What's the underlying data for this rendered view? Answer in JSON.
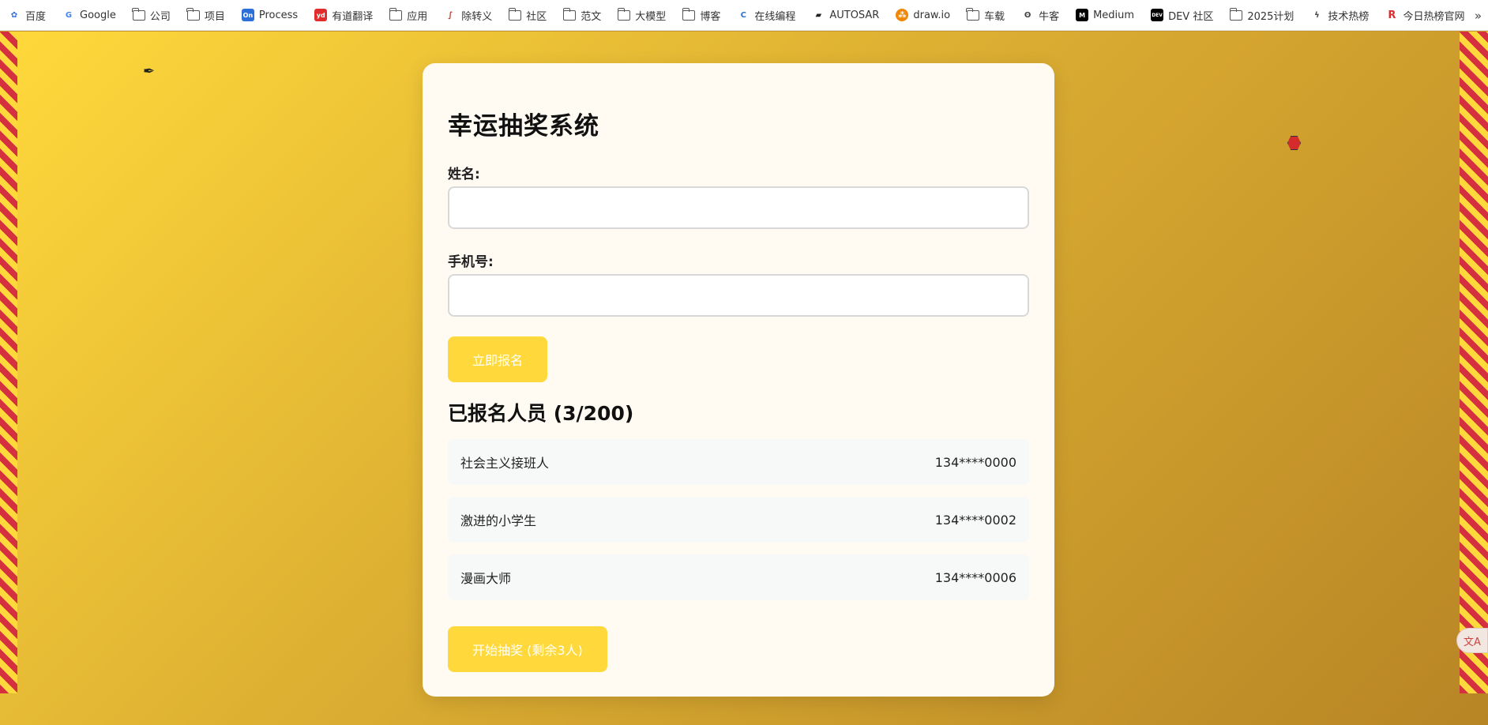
{
  "bookmarks": [
    {
      "label": "百度",
      "icon": "baidu-icon"
    },
    {
      "label": "Google",
      "icon": "google-icon"
    },
    {
      "label": "公司",
      "icon": "folder-icon"
    },
    {
      "label": "项目",
      "icon": "folder-icon"
    },
    {
      "label": "Process",
      "icon": "processon-icon"
    },
    {
      "label": "有道翻译",
      "icon": "youdao-icon"
    },
    {
      "label": "应用",
      "icon": "folder-icon"
    },
    {
      "label": "除转义",
      "icon": "unescape-icon"
    },
    {
      "label": "社区",
      "icon": "folder-icon"
    },
    {
      "label": "范文",
      "icon": "folder-icon"
    },
    {
      "label": "大模型",
      "icon": "folder-icon"
    },
    {
      "label": "博客",
      "icon": "folder-icon"
    },
    {
      "label": "在线编程",
      "icon": "online-coding-icon"
    },
    {
      "label": "AUTOSAR",
      "icon": "autosar-icon"
    },
    {
      "label": "draw.io",
      "icon": "drawio-icon"
    },
    {
      "label": "车载",
      "icon": "folder-icon"
    },
    {
      "label": "牛客",
      "icon": "nowcoder-icon"
    },
    {
      "label": "Medium",
      "icon": "medium-icon"
    },
    {
      "label": "DEV 社区",
      "icon": "dev-icon"
    },
    {
      "label": "2025计划",
      "icon": "folder-icon"
    },
    {
      "label": "技术热榜",
      "icon": "tech-hot-icon"
    },
    {
      "label": "今日热榜官网",
      "icon": "rebang-icon"
    }
  ],
  "overflow_label": "»",
  "form": {
    "title": "幸运抽奖系统",
    "name_label": "姓名:",
    "name_value": "",
    "phone_label": "手机号:",
    "phone_value": "",
    "register_label": "立即报名"
  },
  "participants": {
    "heading": "已报名人员 (3/200)",
    "items": [
      {
        "name": "社会主义接班人",
        "phone": "134****0000"
      },
      {
        "name": "激进的小学生",
        "phone": "134****0002"
      },
      {
        "name": "漫画大师",
        "phone": "134****0006"
      }
    ]
  },
  "draw_label": "开始抽奖 (剩余3人)",
  "colors": {
    "accent": "#ffd93b",
    "stripe_red": "#d4303f",
    "card_bg": "#fffbf2"
  }
}
